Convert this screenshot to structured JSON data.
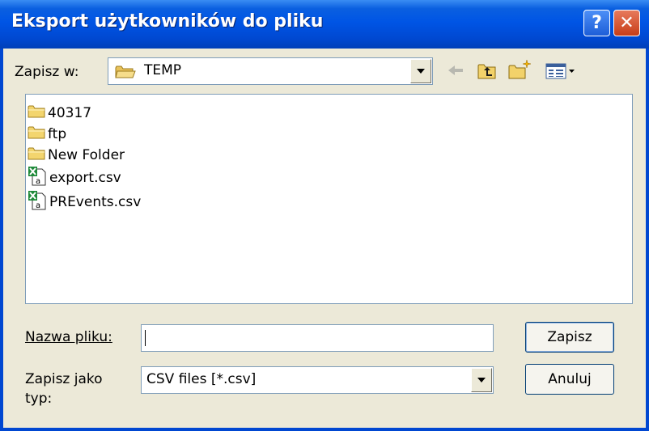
{
  "window": {
    "title": "Eksport użytkowników do pliku",
    "help_glyph": "?",
    "close_glyph": "✕"
  },
  "location": {
    "label": "Zapisz w:",
    "value": "TEMP"
  },
  "toolbar": {
    "icons": [
      "back-arrow-icon",
      "up-folder-icon",
      "new-folder-icon",
      "view-menu-icon"
    ]
  },
  "files": [
    {
      "name": "40317",
      "type": "folder"
    },
    {
      "name": "ftp",
      "type": "folder"
    },
    {
      "name": "New Folder",
      "type": "folder"
    },
    {
      "name": "export.csv",
      "type": "excel-csv"
    },
    {
      "name": "PREvents.csv",
      "type": "excel-csv"
    }
  ],
  "filename": {
    "label": "Nazwa pliku:",
    "value": ""
  },
  "filetype": {
    "label": "Zapisz jako typ:",
    "label_line1": "Zapisz jako",
    "label_line2": "typ:",
    "value": "CSV files [*.csv]"
  },
  "buttons": {
    "save": "Zapisz",
    "cancel": "Anuluj"
  },
  "colors": {
    "titlebar": "#0055e5",
    "dialog_bg": "#ece9d8",
    "border": "#7f9db9"
  }
}
